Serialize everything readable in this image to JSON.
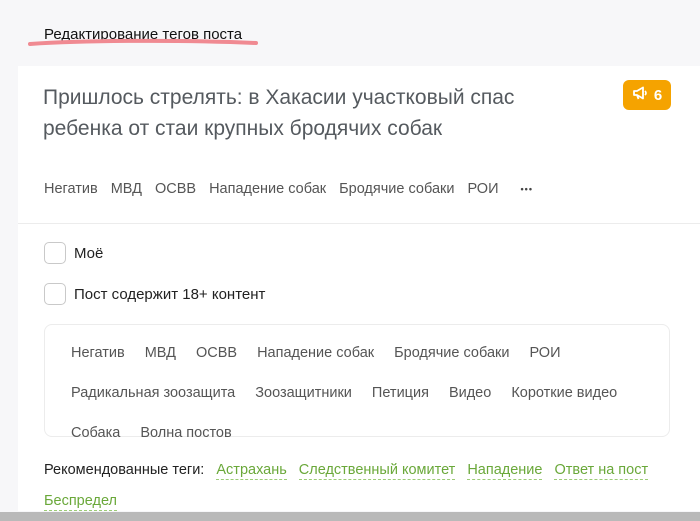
{
  "page": {
    "heading": "Редактирование тегов поста"
  },
  "post": {
    "title": "Пришлось стрелять: в Хакасии участковый спас ребенка от стаи крупных бродячих собак",
    "rating": "6",
    "tags": [
      "Негатив",
      "МВД",
      "ОСВВ",
      "Нападение собак",
      "Бродячие собаки",
      "РОИ"
    ],
    "more_icon": "ellipsis-icon",
    "badge_icon": "megaphone-icon"
  },
  "options": {
    "mine_label": "Моё",
    "nsfw_label": "Пост содержит 18+ контент"
  },
  "tag_editor": {
    "tags": [
      "Негатив",
      "МВД",
      "ОСВВ",
      "Нападение собак",
      "Бродячие собаки",
      "РОИ",
      "Радикальная зоозащита",
      "Зоозащитники",
      "Петиция",
      "Видео",
      "Короткие видео",
      "Собака",
      "Волна постов"
    ]
  },
  "recommended": {
    "label": "Рекомендованные теги:",
    "tags": [
      "Астрахань",
      "Следственный комитет",
      "Нападение",
      "Ответ на пост",
      "Беспредел"
    ]
  },
  "colors": {
    "badge": "#f5a300",
    "recommended_tag": "#6aa83a",
    "underline_mark": "#f08a92"
  }
}
